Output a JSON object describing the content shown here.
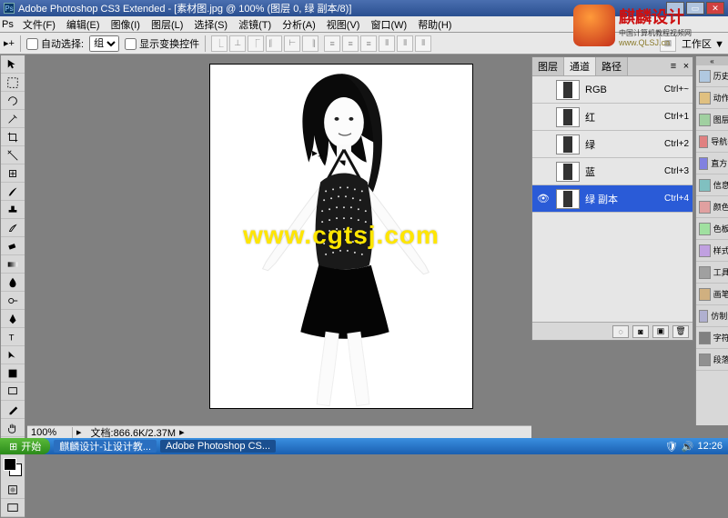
{
  "app_title": "Adobe Photoshop CS3 Extended - [素材图.jpg @ 100% (图层 0, 绿 副本/8)]",
  "menu": [
    "文件(F)",
    "编辑(E)",
    "图像(I)",
    "图层(L)",
    "选择(S)",
    "滤镜(T)",
    "分析(A)",
    "视图(V)",
    "窗口(W)",
    "帮助(H)"
  ],
  "options": {
    "auto_select_label": "自动选择:",
    "group_value": "组",
    "show_transform_label": "显示变换控件",
    "workspace_label": "工作区 ▼"
  },
  "channels_panel": {
    "tabs": [
      "图层",
      "通道",
      "路径"
    ],
    "active_tab": 1,
    "rows": [
      {
        "name": "RGB",
        "shortcut": "Ctrl+~",
        "visible": false
      },
      {
        "name": "红",
        "shortcut": "Ctrl+1",
        "visible": false
      },
      {
        "name": "绿",
        "shortcut": "Ctrl+2",
        "visible": false
      },
      {
        "name": "蓝",
        "shortcut": "Ctrl+3",
        "visible": false
      },
      {
        "name": "绿 副本",
        "shortcut": "Ctrl+4",
        "visible": true,
        "selected": true
      }
    ]
  },
  "right_dock": [
    {
      "label": "历史",
      "icon": "#b0c8e0"
    },
    {
      "label": "动作",
      "icon": "#e0c080"
    },
    {
      "label": "图层",
      "icon": "#a0d0a0"
    },
    {
      "label": "导航器",
      "icon": "#e08080"
    },
    {
      "label": "直方图",
      "icon": "#8080e0"
    },
    {
      "label": "信息",
      "icon": "#80c0c0"
    },
    {
      "label": "颜色",
      "icon": "#e0a0a0"
    },
    {
      "label": "色板",
      "icon": "#a0e0a0"
    },
    {
      "label": "样式",
      "icon": "#c0a0e0"
    },
    {
      "label": "工具",
      "icon": "#a0a0a0"
    },
    {
      "label": "画笔",
      "icon": "#d0b080"
    },
    {
      "label": "仿制源",
      "icon": "#b0b0d0"
    },
    {
      "label": "字符",
      "icon": "#808080"
    },
    {
      "label": "段落",
      "icon": "#909090"
    }
  ],
  "status": {
    "zoom": "100%",
    "doc": "文档:866.6K/2.37M"
  },
  "watermark": "www.cgtsj.com",
  "brand": {
    "title": "麒麟设计",
    "sub": "中国计算机教程视频网",
    "url": "www.QLSJ.cn"
  },
  "taskbar": {
    "start": "开始",
    "items": [
      "麒麟设计-让设计教...",
      "Adobe Photoshop CS..."
    ],
    "time": "12:26"
  }
}
